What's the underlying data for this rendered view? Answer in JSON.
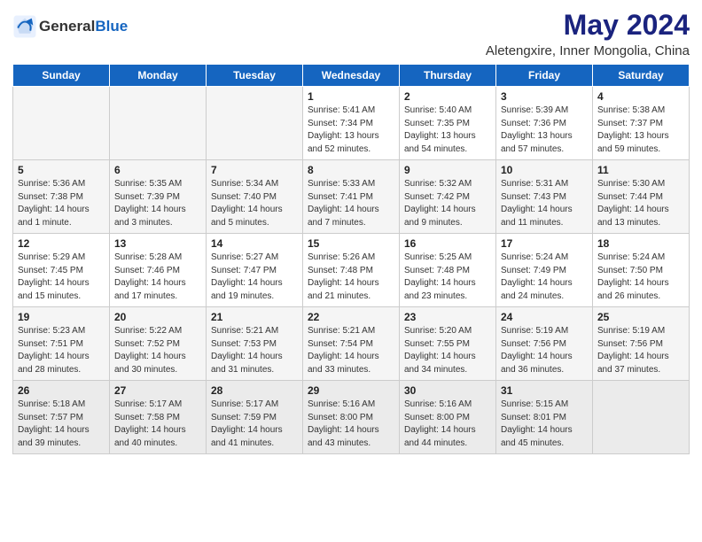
{
  "logo": {
    "general": "General",
    "blue": "Blue"
  },
  "title": "May 2024",
  "subtitle": "Aletengxire, Inner Mongolia, China",
  "headers": [
    "Sunday",
    "Monday",
    "Tuesday",
    "Wednesday",
    "Thursday",
    "Friday",
    "Saturday"
  ],
  "weeks": [
    [
      {
        "day": "",
        "info": "",
        "empty": true
      },
      {
        "day": "",
        "info": "",
        "empty": true
      },
      {
        "day": "",
        "info": "",
        "empty": true
      },
      {
        "day": "1",
        "info": "Sunrise: 5:41 AM\nSunset: 7:34 PM\nDaylight: 13 hours\nand 52 minutes.",
        "empty": false
      },
      {
        "day": "2",
        "info": "Sunrise: 5:40 AM\nSunset: 7:35 PM\nDaylight: 13 hours\nand 54 minutes.",
        "empty": false
      },
      {
        "day": "3",
        "info": "Sunrise: 5:39 AM\nSunset: 7:36 PM\nDaylight: 13 hours\nand 57 minutes.",
        "empty": false
      },
      {
        "day": "4",
        "info": "Sunrise: 5:38 AM\nSunset: 7:37 PM\nDaylight: 13 hours\nand 59 minutes.",
        "empty": false
      }
    ],
    [
      {
        "day": "5",
        "info": "Sunrise: 5:36 AM\nSunset: 7:38 PM\nDaylight: 14 hours\nand 1 minute.",
        "empty": false
      },
      {
        "day": "6",
        "info": "Sunrise: 5:35 AM\nSunset: 7:39 PM\nDaylight: 14 hours\nand 3 minutes.",
        "empty": false
      },
      {
        "day": "7",
        "info": "Sunrise: 5:34 AM\nSunset: 7:40 PM\nDaylight: 14 hours\nand 5 minutes.",
        "empty": false
      },
      {
        "day": "8",
        "info": "Sunrise: 5:33 AM\nSunset: 7:41 PM\nDaylight: 14 hours\nand 7 minutes.",
        "empty": false
      },
      {
        "day": "9",
        "info": "Sunrise: 5:32 AM\nSunset: 7:42 PM\nDaylight: 14 hours\nand 9 minutes.",
        "empty": false
      },
      {
        "day": "10",
        "info": "Sunrise: 5:31 AM\nSunset: 7:43 PM\nDaylight: 14 hours\nand 11 minutes.",
        "empty": false
      },
      {
        "day": "11",
        "info": "Sunrise: 5:30 AM\nSunset: 7:44 PM\nDaylight: 14 hours\nand 13 minutes.",
        "empty": false
      }
    ],
    [
      {
        "day": "12",
        "info": "Sunrise: 5:29 AM\nSunset: 7:45 PM\nDaylight: 14 hours\nand 15 minutes.",
        "empty": false
      },
      {
        "day": "13",
        "info": "Sunrise: 5:28 AM\nSunset: 7:46 PM\nDaylight: 14 hours\nand 17 minutes.",
        "empty": false
      },
      {
        "day": "14",
        "info": "Sunrise: 5:27 AM\nSunset: 7:47 PM\nDaylight: 14 hours\nand 19 minutes.",
        "empty": false
      },
      {
        "day": "15",
        "info": "Sunrise: 5:26 AM\nSunset: 7:48 PM\nDaylight: 14 hours\nand 21 minutes.",
        "empty": false
      },
      {
        "day": "16",
        "info": "Sunrise: 5:25 AM\nSunset: 7:48 PM\nDaylight: 14 hours\nand 23 minutes.",
        "empty": false
      },
      {
        "day": "17",
        "info": "Sunrise: 5:24 AM\nSunset: 7:49 PM\nDaylight: 14 hours\nand 24 minutes.",
        "empty": false
      },
      {
        "day": "18",
        "info": "Sunrise: 5:24 AM\nSunset: 7:50 PM\nDaylight: 14 hours\nand 26 minutes.",
        "empty": false
      }
    ],
    [
      {
        "day": "19",
        "info": "Sunrise: 5:23 AM\nSunset: 7:51 PM\nDaylight: 14 hours\nand 28 minutes.",
        "empty": false
      },
      {
        "day": "20",
        "info": "Sunrise: 5:22 AM\nSunset: 7:52 PM\nDaylight: 14 hours\nand 30 minutes.",
        "empty": false
      },
      {
        "day": "21",
        "info": "Sunrise: 5:21 AM\nSunset: 7:53 PM\nDaylight: 14 hours\nand 31 minutes.",
        "empty": false
      },
      {
        "day": "22",
        "info": "Sunrise: 5:21 AM\nSunset: 7:54 PM\nDaylight: 14 hours\nand 33 minutes.",
        "empty": false
      },
      {
        "day": "23",
        "info": "Sunrise: 5:20 AM\nSunset: 7:55 PM\nDaylight: 14 hours\nand 34 minutes.",
        "empty": false
      },
      {
        "day": "24",
        "info": "Sunrise: 5:19 AM\nSunset: 7:56 PM\nDaylight: 14 hours\nand 36 minutes.",
        "empty": false
      },
      {
        "day": "25",
        "info": "Sunrise: 5:19 AM\nSunset: 7:56 PM\nDaylight: 14 hours\nand 37 minutes.",
        "empty": false
      }
    ],
    [
      {
        "day": "26",
        "info": "Sunrise: 5:18 AM\nSunset: 7:57 PM\nDaylight: 14 hours\nand 39 minutes.",
        "empty": false
      },
      {
        "day": "27",
        "info": "Sunrise: 5:17 AM\nSunset: 7:58 PM\nDaylight: 14 hours\nand 40 minutes.",
        "empty": false
      },
      {
        "day": "28",
        "info": "Sunrise: 5:17 AM\nSunset: 7:59 PM\nDaylight: 14 hours\nand 41 minutes.",
        "empty": false
      },
      {
        "day": "29",
        "info": "Sunrise: 5:16 AM\nSunset: 8:00 PM\nDaylight: 14 hours\nand 43 minutes.",
        "empty": false
      },
      {
        "day": "30",
        "info": "Sunrise: 5:16 AM\nSunset: 8:00 PM\nDaylight: 14 hours\nand 44 minutes.",
        "empty": false
      },
      {
        "day": "31",
        "info": "Sunrise: 5:15 AM\nSunset: 8:01 PM\nDaylight: 14 hours\nand 45 minutes.",
        "empty": false
      },
      {
        "day": "",
        "info": "",
        "empty": true
      }
    ]
  ]
}
